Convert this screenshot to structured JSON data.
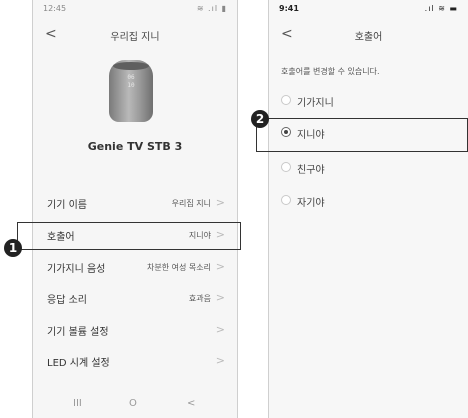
{
  "left_screen": {
    "status_time": "12:45",
    "status_icons": "≋ .ıl ▮",
    "back_glyph": "<",
    "title": "우리집 지니",
    "speaker_display": "06\n10",
    "device_name": "Genie TV STB 3",
    "menu": [
      {
        "label": "기기 이름",
        "value": "우리집 지니"
      },
      {
        "label": "호출어",
        "value": "지니야"
      },
      {
        "label": "기가지니 음성",
        "value": "차분한 여성 목소리"
      },
      {
        "label": "응답 소리",
        "value": "효과음"
      },
      {
        "label": "기기 볼륨 설정",
        "value": ""
      },
      {
        "label": "LED 시계 설정",
        "value": ""
      }
    ],
    "chevron_glyph": ">",
    "nav": {
      "recent": "III",
      "home": "O",
      "back": "<"
    }
  },
  "right_screen": {
    "status_time": "9:41",
    "status_icons": ".ıl ≋ ▬",
    "back_glyph": "<",
    "title": "호출어",
    "description": "호출어를 변경할 수 있습니다.",
    "options": [
      {
        "label": "기가지니",
        "selected": false
      },
      {
        "label": "지니야",
        "selected": true
      },
      {
        "label": "친구야",
        "selected": false
      },
      {
        "label": "자기야",
        "selected": false
      }
    ]
  },
  "callouts": {
    "step1": "1",
    "step2": "2"
  }
}
